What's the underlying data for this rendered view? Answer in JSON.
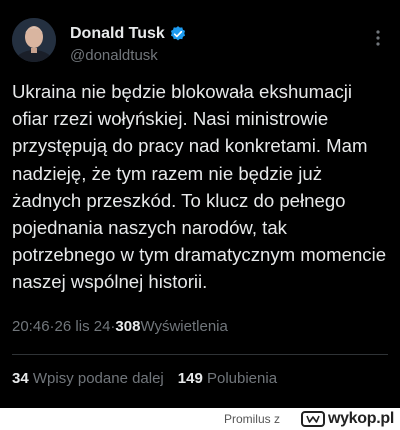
{
  "tweet": {
    "display_name": "Donald Tusk",
    "handle": "@donaldtusk",
    "text": "Ukraina nie będzie blokowała ekshumacji ofiar rzezi wołyńskiej. Nasi ministrowie przystępują do pracy nad konkretami. Mam nadzieję, że tym razem nie będzie już żadnych przeszkód. To klucz do pełnego pojednania naszych narodów, tak potrzebnego w tym dramatycznym momencie naszej wspólnej historii.",
    "time": "20:46",
    "separator": " · ",
    "date": "26 lis 24",
    "views_count": "308",
    "views_label": " Wyświetlenia",
    "retweets_count": "34",
    "retweets_label": " Wpisy podane dalej",
    "likes_count": "149",
    "likes_label": " Polubienia",
    "verified_color": "#1d9bf0",
    "icons": {
      "avatar": "avatar-photo",
      "verified": "verified-badge-icon",
      "more": "more-dots-icon"
    }
  },
  "footer": {
    "author": "Promilus",
    "author_suffix": " z",
    "site": "wykop.pl"
  }
}
